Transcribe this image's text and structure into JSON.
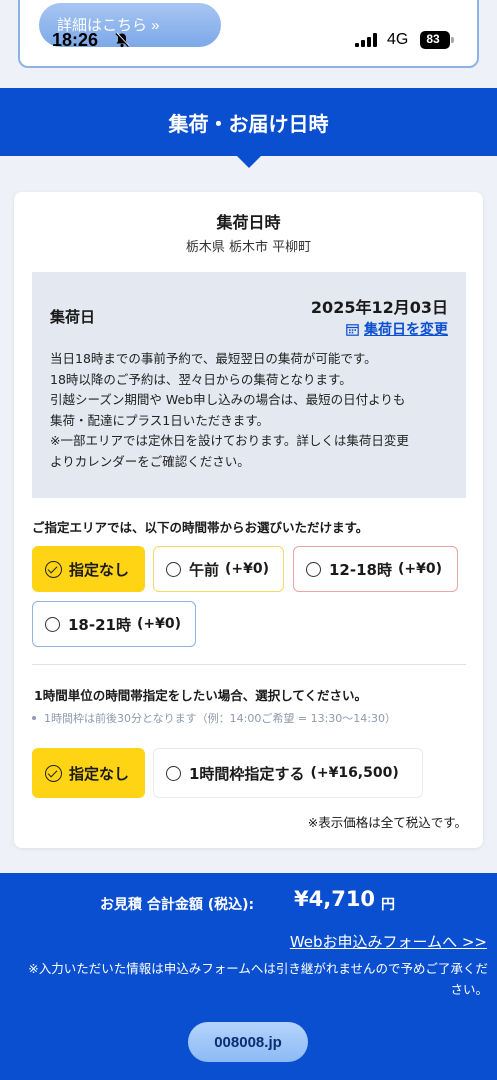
{
  "status_bar": {
    "time": "18:26",
    "network": "4G",
    "battery": "83"
  },
  "top_card": {
    "detail_button": "詳細はこちら »"
  },
  "section": {
    "title": "集荷・お届け日時"
  },
  "pickup": {
    "title": "集荷日時",
    "location": "栃木県 栃木市 平柳町",
    "date_label": "集荷日",
    "date_value": "2025年12月03日",
    "change_link": "集荷日を変更",
    "info_lines": [
      "当日18時までの事前予約で、最短翌日の集荷が可能です。",
      "18時以降のご予約は、翌々日からの集荷となります。",
      "引越シーズン期間や Web申し込みの場合は、最短の日付よりも",
      "集荷・配達にプラス1日いただきます。",
      "※一部エリアでは定休日を設けております。詳しくは集荷日変更",
      "よりカレンダーをご確認ください。"
    ]
  },
  "time_slots": {
    "note": "ご指定エリアでは、以下の時間帯からお選びいただけます。",
    "options": [
      {
        "label": "指定なし",
        "price": "",
        "selected": true,
        "border": "#ffd414"
      },
      {
        "label": "午前",
        "price": "(+¥0)",
        "selected": false,
        "border": "#f3d86a"
      },
      {
        "label": "12-18時",
        "price": "(+¥0)",
        "selected": false,
        "border": "#eea4a4"
      },
      {
        "label": "18-21時",
        "price": "(+¥0)",
        "selected": false,
        "border": "#8fb4e0"
      }
    ]
  },
  "hourly": {
    "note": "1時間単位の時間帯指定をしたい場合、選択してください。",
    "sub": "1時間枠は前後30分となります（例：14:00ご希望 = 13:30〜14:30）",
    "options": [
      {
        "label": "指定なし",
        "price": "",
        "selected": true
      },
      {
        "label": "1時間枠指定する",
        "price": "(+¥16,500)",
        "selected": false
      }
    ]
  },
  "tax_note": "※表示価格は全て税込です。",
  "footer": {
    "total_label": "お見積 合計金額 (税込):",
    "total_amount": "¥4,710",
    "total_unit": "円",
    "web_link": "Webお申込みフォームへ >>",
    "note": "※入力いただいた情報は申込みフォームへは引き継がれませんので予めご了承ください。",
    "domain": "008008.jp"
  }
}
